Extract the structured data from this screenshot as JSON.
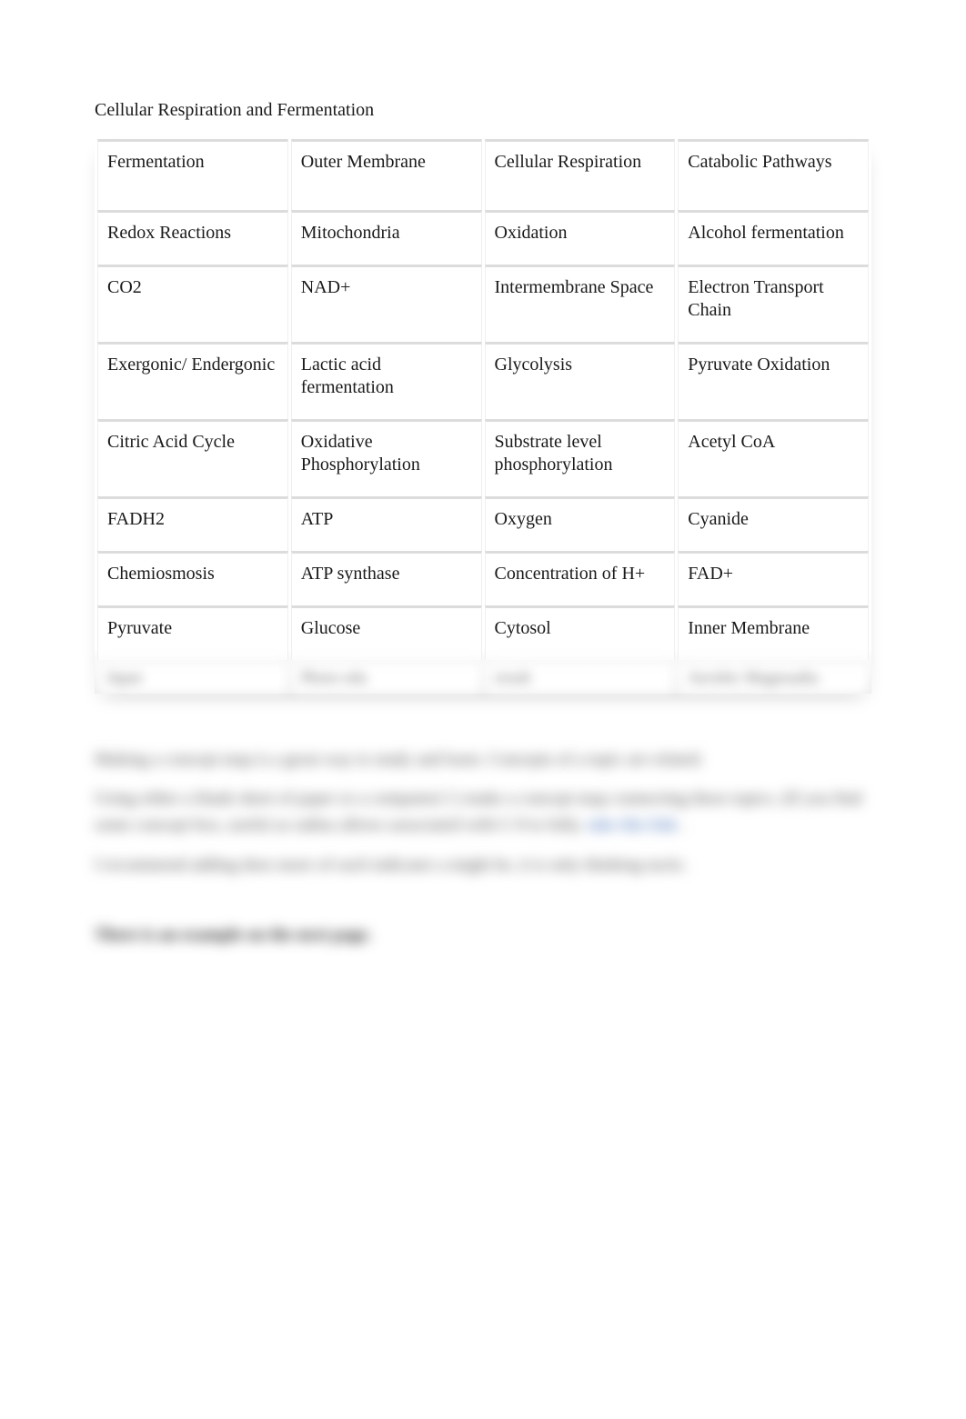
{
  "title": "Cellular Respiration and Fermentation",
  "rows": [
    [
      "Fermentation",
      "Outer Membrane",
      "Cellular Respiration",
      "Catabolic Pathways"
    ],
    [
      "Redox Reactions",
      "Mitochondria",
      "Oxidation",
      "Alcohol fermentation"
    ],
    [
      "CO2",
      "NAD+",
      "Intermembrane Space",
      "Electron Transport Chain"
    ],
    [
      "Exergonic/ Endergonic",
      "Lactic acid fermentation",
      "Glycolysis",
      "Pyruvate Oxidation"
    ],
    [
      "Citric Acid Cycle",
      "Oxidative Phosphorylation",
      "Substrate level phosphorylation",
      "Acetyl CoA"
    ],
    [
      "FADH2",
      "ATP",
      "Oxygen",
      "Cyanide"
    ],
    [
      "Chemiosmosis",
      "ATP synthase",
      "Concentration of H+",
      "FAD+"
    ],
    [
      "Pyruvate",
      "Glucose",
      "Cytosol",
      "Inner Membrane"
    ]
  ],
  "blurred_row": [
    "Input",
    "Photo edu",
    "result",
    "Aerobic   Magnoadia"
  ],
  "blurred_paragraphs": {
    "p1": "Making a concept map is a great way to study and learn. Concepts of a topic are related.",
    "p2a": "Using either a blank sheet of paper or a computer( I  ) make a concept map connecting these topics. (If you find some concept box, useful as radius allows associated with C-9 to fully. ",
    "p2b": "take this link",
    "p2c": " .",
    "p3": "I recommend adding does more of each indicator a might be, it is only thinking tactic.",
    "h_next": "There is an example on the next page."
  }
}
